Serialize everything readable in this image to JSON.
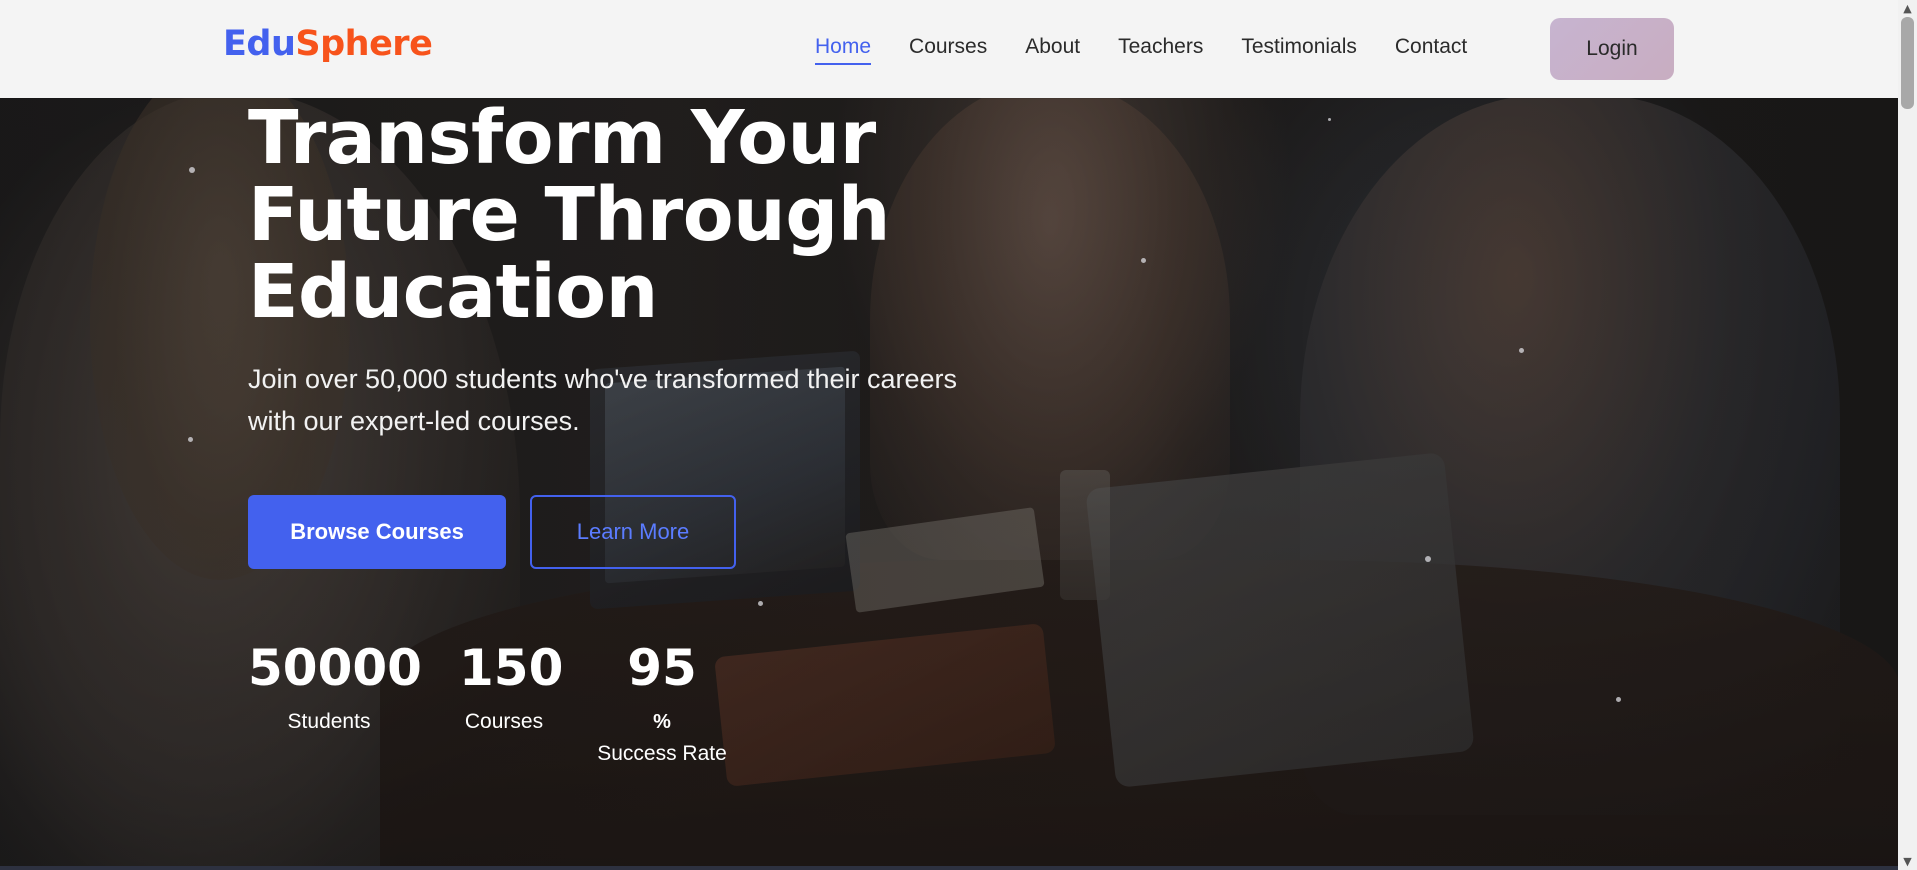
{
  "brand": {
    "logo_part1": "Edu",
    "logo_part2": "Sphere",
    "primary_color": "#4361ee",
    "accent_color": "#f7531b"
  },
  "nav": {
    "items": [
      {
        "label": "Home",
        "active": true
      },
      {
        "label": "Courses",
        "active": false
      },
      {
        "label": "About",
        "active": false
      },
      {
        "label": "Teachers",
        "active": false
      },
      {
        "label": "Testimonials",
        "active": false
      },
      {
        "label": "Contact",
        "active": false
      }
    ],
    "login_label": "Login"
  },
  "hero": {
    "title_line1": "Transform Your",
    "title_line2": "Future Through",
    "title_line3": "Education",
    "subtitle_line1": "Join over 50,000 students who've transformed their careers",
    "subtitle_line2": "with our expert-led courses.",
    "primary_button": "Browse Courses",
    "secondary_button": "Learn More",
    "background_image": "students studying together with laptops at a cafe table"
  },
  "stats": [
    {
      "number": "50000",
      "label": "Students"
    },
    {
      "number": "150",
      "label": "Courses"
    },
    {
      "number": "95",
      "unit": "%",
      "label": "Success Rate"
    }
  ],
  "icons": {
    "scroll_up": "▲",
    "scroll_down": "▼"
  }
}
